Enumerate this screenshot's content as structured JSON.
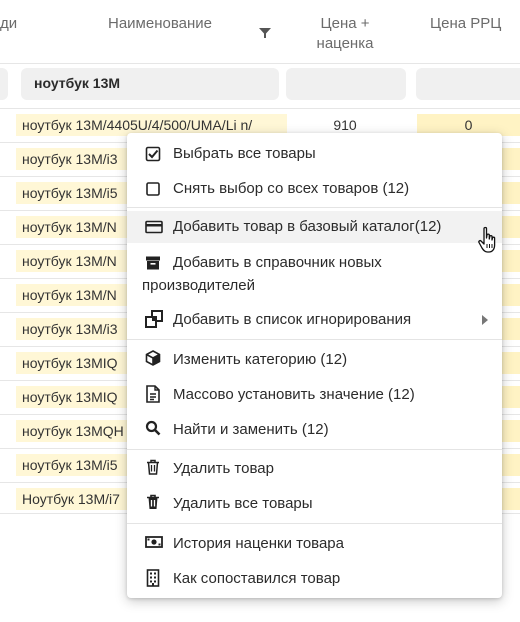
{
  "header": {
    "col_prev": "ди",
    "col_name": "Наименование",
    "col_price_line1": "Цена +",
    "col_price_line2": "наценка",
    "col_rrc": "Цена РРЦ"
  },
  "filter": {
    "name_value": "ноутбук 13M"
  },
  "rows": [
    {
      "name": "ноутбук 13M/4405U/4/500/UMA/Li n/",
      "price": "910",
      "rrc": "0"
    },
    {
      "name": "ноутбук 13M/i3"
    },
    {
      "name": "ноутбук 13M/i5"
    },
    {
      "name": "ноутбук 13M/N"
    },
    {
      "name": "ноутбук 13M/N"
    },
    {
      "name": "ноутбук 13M/N"
    },
    {
      "name": "ноутбук 13M/i3"
    },
    {
      "name": "ноутбук 13MIQ"
    },
    {
      "name": "ноутбук 13MIQ"
    },
    {
      "name": "ноутбук 13MQH"
    },
    {
      "name": "ноутбук 13M/i5"
    },
    {
      "name": "Ноутбук 13M/i7"
    }
  ],
  "menu": {
    "select_all": "Выбрать все товары",
    "deselect_all": "Снять выбор со всех товаров (12)",
    "add_base_catalog": "Добавить товар в базовый каталог(12)",
    "add_manufacturers_line1": "Добавить в справочник новых",
    "add_manufacturers_line2": "производителей",
    "add_ignore": "Добавить в список игнорирования",
    "change_category": "Изменить категорию (12)",
    "mass_set_value": "Массово установить значение (12)",
    "find_replace": "Найти и заменить (12)",
    "delete_item": "Удалить товар",
    "delete_all": "Удалить все товары",
    "markup_history": "История наценки товара",
    "how_matched": "Как сопоставился товар"
  },
  "icons": {
    "filter": "filter-icon",
    "checkbox_checked": "checkbox-checked-icon",
    "checkbox_empty": "checkbox-empty-icon",
    "card": "credit-card-icon",
    "archive": "archive-icon",
    "ignore": "layers-icon",
    "cube": "cube-icon",
    "document": "document-icon",
    "search": "search-icon",
    "trash": "trash-icon",
    "money": "money-icon",
    "building": "building-icon",
    "cursor": "hand-pointer-icon"
  },
  "colors": {
    "highlight_name": "#fff7d6",
    "highlight_rrc": "#fff3c4",
    "menu_hover": "#f2f2f2"
  }
}
